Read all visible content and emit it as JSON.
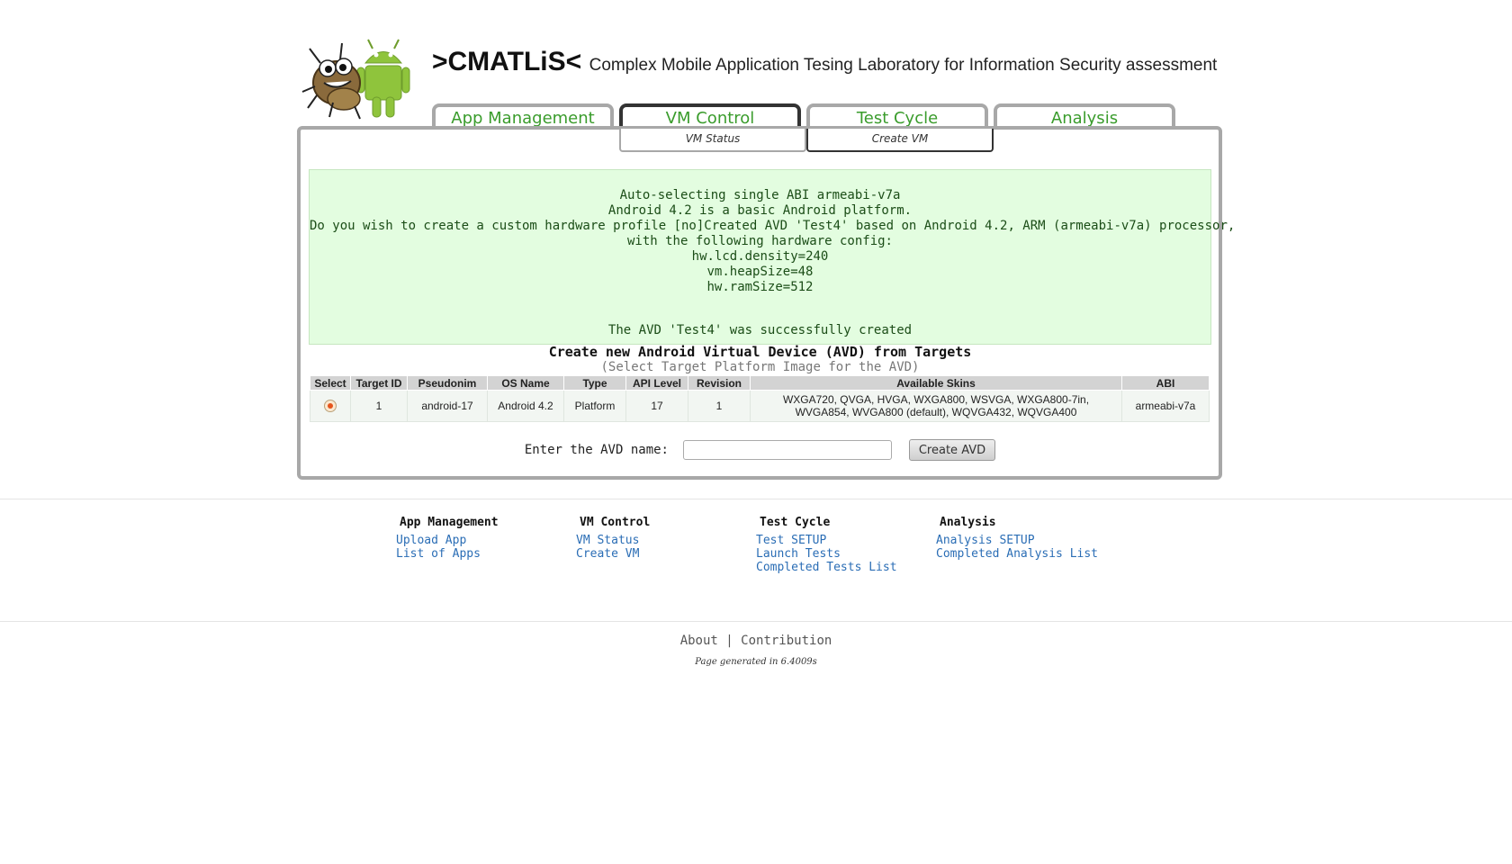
{
  "header": {
    "brand": ">CMATLiS<",
    "subtitle": "Complex Mobile Application Tesing Laboratory for Information Security assessment"
  },
  "tabs": [
    {
      "label": "App Management",
      "active": false
    },
    {
      "label": "VM Control",
      "active": true
    },
    {
      "label": "Test Cycle",
      "active": false
    },
    {
      "label": "Analysis",
      "active": false
    }
  ],
  "subtabs": [
    {
      "label": "VM Status",
      "active": false
    },
    {
      "label": "Create VM",
      "active": true
    }
  ],
  "message": {
    "lines": [
      "Auto-selecting single ABI armeabi-v7a",
      "Android 4.2 is a basic Android platform.",
      "Do you wish to create a custom hardware profile [no]Created AVD 'Test4' based on Android 4.2, ARM (armeabi-v7a) processor,",
      "with the following hardware config:",
      "hw.lcd.density=240",
      "vm.heapSize=48",
      "hw.ramSize=512"
    ],
    "success": "The AVD 'Test4' was successfully created"
  },
  "avd": {
    "title": "Create new Android Virtual Device (AVD) from Targets",
    "subtitle": "(Select Target Platform Image for the AVD)",
    "columns": [
      "Select",
      "Target ID",
      "Pseudonim",
      "OS Name",
      "Type",
      "API Level",
      "Revision",
      "Available Skins",
      "ABI"
    ],
    "rows": [
      {
        "selected": true,
        "target_id": "1",
        "pseudonim": "android-17",
        "os_name": "Android 4.2",
        "type": "Platform",
        "api_level": "17",
        "revision": "1",
        "skins": "WXGA720, QVGA, HVGA, WXGA800, WSVGA, WXGA800-7in, WVGA854, WVGA800 (default), WQVGA432, WQVGA400",
        "abi": "armeabi-v7a"
      }
    ],
    "form": {
      "label": "Enter the AVD name:",
      "value": "",
      "button": "Create AVD"
    }
  },
  "footer_nav": [
    {
      "heading": "App Management",
      "links": [
        "Upload App",
        "List of Apps"
      ]
    },
    {
      "heading": "VM Control",
      "links": [
        "VM Status",
        "Create VM"
      ]
    },
    {
      "heading": "Test Cycle",
      "links": [
        "Test SETUP",
        "Launch Tests",
        "Completed Tests List"
      ]
    },
    {
      "heading": "Analysis",
      "links": [
        "Analysis SETUP",
        "Completed Analysis List"
      ]
    }
  ],
  "bottom": {
    "about": "About",
    "separator": "|",
    "contribution": "Contribution",
    "generated": "Page generated in 6.4009s"
  }
}
